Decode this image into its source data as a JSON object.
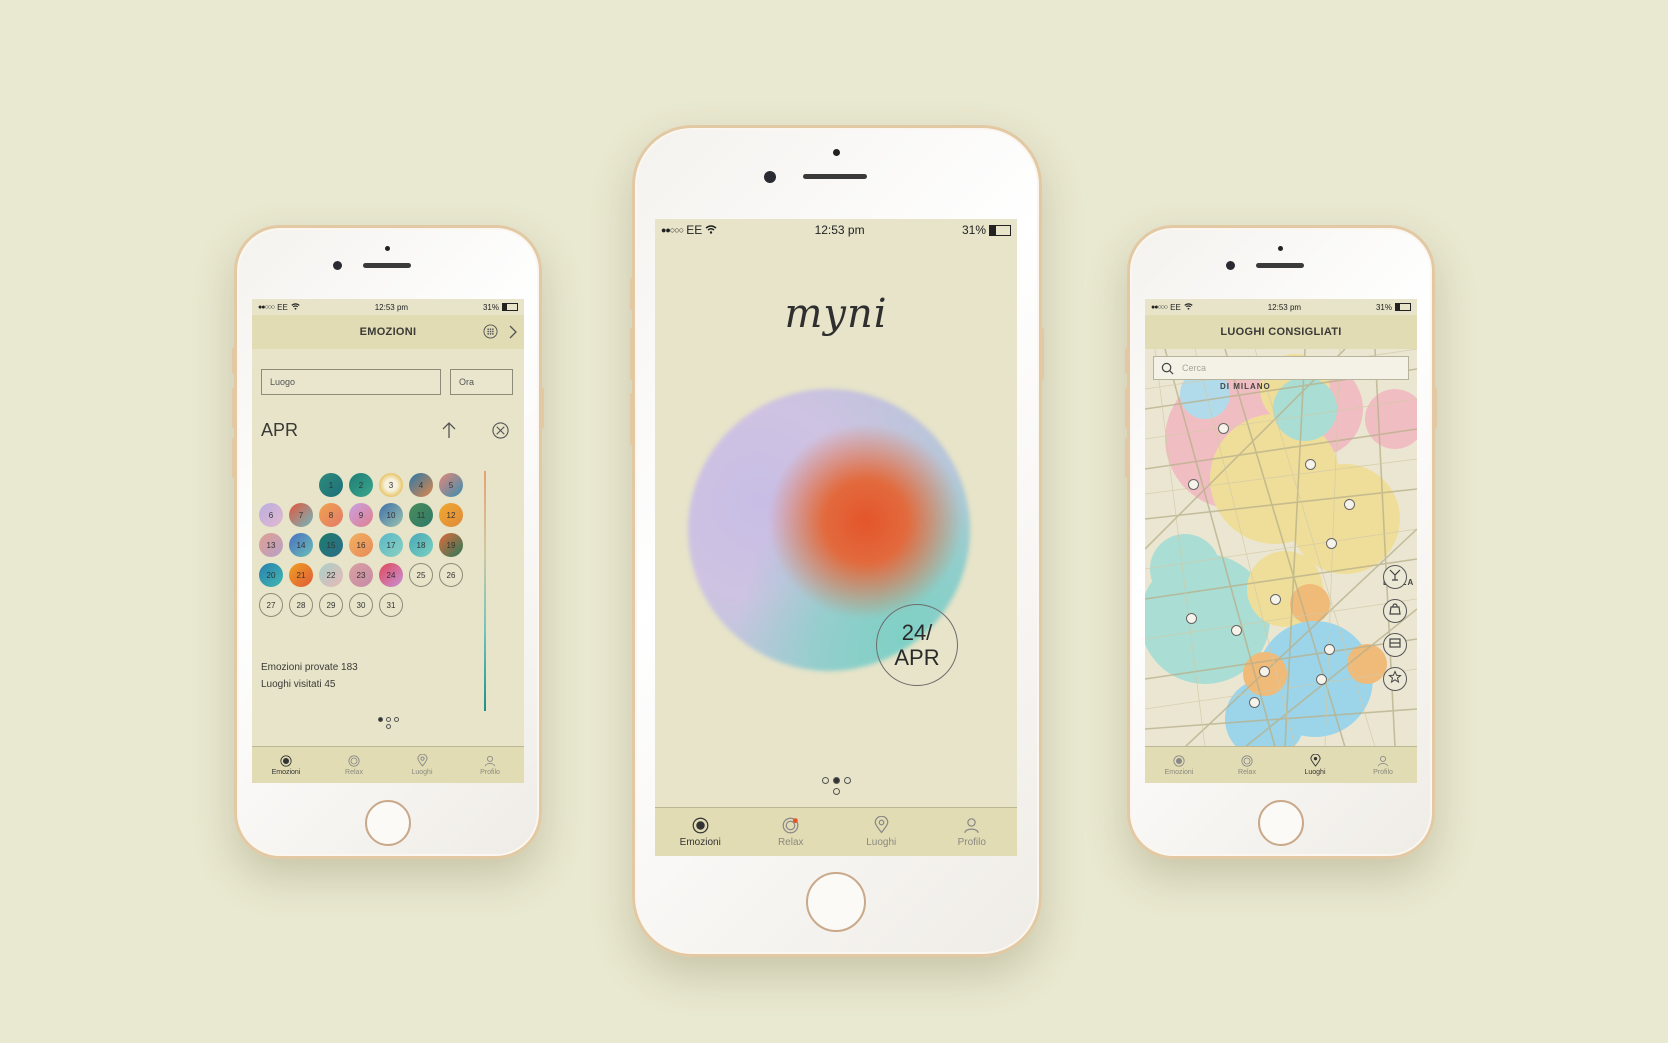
{
  "status_bar": {
    "carrier": "EE",
    "time": "12:53 pm",
    "battery": "31%",
    "battery_fraction": 0.31
  },
  "left_screen": {
    "title": "EMOZIONI",
    "place_placeholder": "Luogo",
    "time_placeholder": "Ora",
    "month": "APR",
    "calendar": {
      "filled_days": [
        "1",
        "2",
        "3",
        "4",
        "5",
        "6",
        "7",
        "8",
        "9",
        "10",
        "11",
        "12",
        "13",
        "14",
        "15",
        "16",
        "17",
        "18",
        "19",
        "20",
        "21",
        "22",
        "23",
        "24"
      ],
      "empty_days": [
        "25",
        "26",
        "27",
        "28",
        "29",
        "30",
        "31"
      ]
    },
    "stats": {
      "emotions": "Emozioni provate 183",
      "places": "Luoghi visitati 45"
    }
  },
  "center_screen": {
    "logo": "myni",
    "date_day": "24/",
    "date_month": "APR"
  },
  "right_screen": {
    "title": "LUOGHI CONSIGLIATI",
    "search_placeholder": "Cerca",
    "map_label": "DI MILANO",
    "map_label_2": "LAZZA"
  },
  "tabs": {
    "emotions": "Emozioni",
    "relax": "Relax",
    "places": "Luoghi",
    "profile": "Profilo"
  },
  "colors": {
    "background": "#e9e8d0",
    "screen": "#e7e4c9",
    "header": "#e2dcb4",
    "accent_orange": "#e4552a",
    "accent_teal": "#1e8f8a",
    "accent_lilac": "#c8bde5",
    "phone_gold": "#e2c9a4"
  }
}
